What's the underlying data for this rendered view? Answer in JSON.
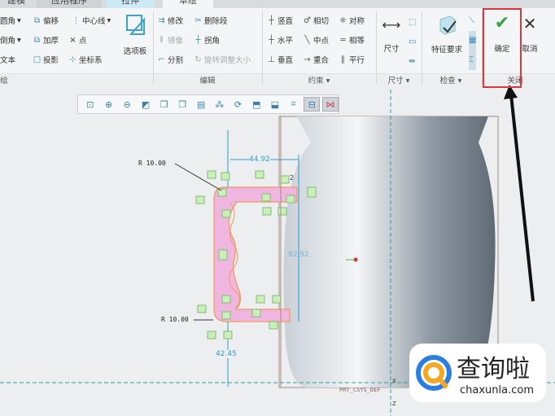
{
  "tabs": [
    "建模",
    "应用程序",
    "拉伸",
    "草绘"
  ],
  "ribbon": {
    "sketch": {
      "items": [
        "圆角",
        "倒角",
        "文本",
        "偏移",
        "加厚",
        "投影",
        "中心线",
        "点",
        "坐标系"
      ],
      "palette": "选项板",
      "label": "绘"
    },
    "edit": {
      "items": [
        "修改",
        "删除段",
        "镜像",
        "拐角",
        "分割",
        "旋转调整大小"
      ],
      "label": "编辑"
    },
    "constrain": {
      "items": [
        "竖直",
        "相切",
        "对称",
        "水平",
        "中点",
        "相等",
        "垂直",
        "重合",
        "平行"
      ],
      "label": "约束"
    },
    "dimension": {
      "big": "尺寸",
      "label": "尺寸"
    },
    "inspect": {
      "big": "特征要求",
      "label": "检查"
    },
    "close": {
      "ok": "确定",
      "cancel": "取消",
      "label": "关闭"
    }
  },
  "toolbar": [
    "refit",
    "zoom-in",
    "zoom-out",
    "repaint",
    "display-style",
    "saved-views",
    "named-views",
    "datum-display",
    "spin-center",
    "perspective",
    "section",
    "annotation",
    "sketch-view",
    "sketch-display"
  ],
  "sketch": {
    "r_top": "R 10.00",
    "r_bottom": "R 10.00",
    "dim_top": "44.92",
    "dim_right": "92.92",
    "dim_bottom": "42.45",
    "csys": "PRT_CSYS_DEF",
    "axis_x": "X",
    "axis_z": "Z",
    "small_2": "2"
  },
  "watermark": {
    "name": "查询啦",
    "url": "chaxunla.com"
  },
  "colors": {
    "accent": "#2f9bd1",
    "highlight": "#d9363e",
    "sketch_fill": "#efb6e0",
    "ok": "#3aa345"
  }
}
